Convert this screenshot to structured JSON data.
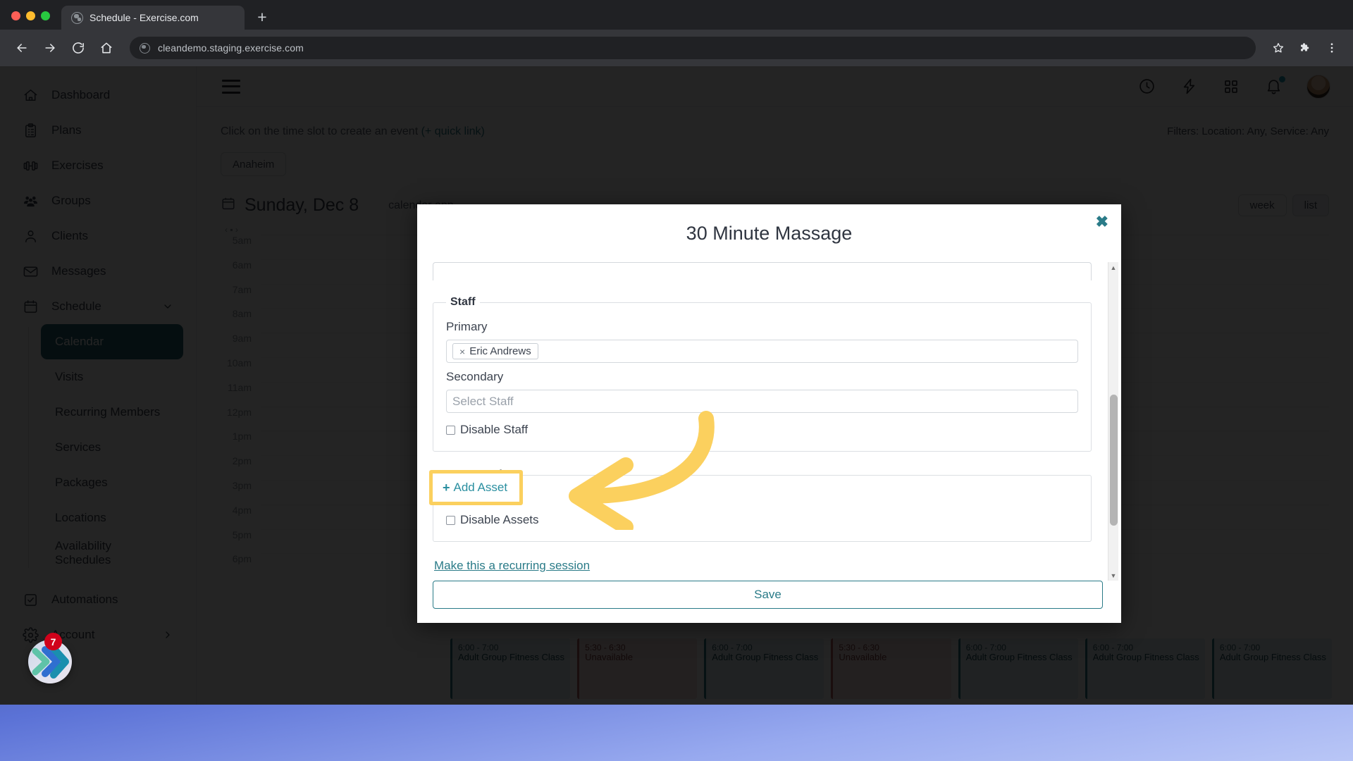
{
  "browser": {
    "tab": {
      "title": "Schedule - Exercise.com",
      "favicon": "globe-icon"
    },
    "new_tab_label": "+",
    "address": "cleandemo.staging.exercise.com",
    "nav": {
      "back": "back-arrow-icon",
      "forward": "forward-arrow-icon",
      "reload": "reload-icon",
      "home": "home-icon",
      "bookmark": "star-icon",
      "extensions": "puzzle-icon",
      "menu": "kebab-menu-icon"
    },
    "traffic_lights": [
      "close",
      "minimize",
      "maximize"
    ]
  },
  "sidebar": {
    "items": [
      {
        "label": "Dashboard",
        "icon": "home-icon"
      },
      {
        "label": "Plans",
        "icon": "clipboard-icon"
      },
      {
        "label": "Exercises",
        "icon": "dumbbell-icon"
      },
      {
        "label": "Groups",
        "icon": "people-icon"
      },
      {
        "label": "Clients",
        "icon": "person-icon"
      },
      {
        "label": "Messages",
        "icon": "envelope-icon"
      },
      {
        "label": "Schedule",
        "icon": "calendar-icon",
        "expanded": true
      }
    ],
    "schedule_subitems": [
      {
        "label": "Calendar",
        "active": true
      },
      {
        "label": "Visits",
        "active": false
      },
      {
        "label": "Recurring Members",
        "active": false
      },
      {
        "label": "Services",
        "active": false
      },
      {
        "label": "Packages",
        "active": false
      },
      {
        "label": "Locations",
        "active": false
      },
      {
        "label": "Availability Schedules",
        "active": false
      }
    ],
    "bottom_items": [
      {
        "label": "Automations",
        "icon": "checkbox-icon"
      },
      {
        "label": "Account",
        "icon": "gear-icon",
        "caret": "chevron-right-icon"
      }
    ]
  },
  "header": {
    "menu_toggle": "hamburger-icon",
    "icons": [
      {
        "name": "clock-icon"
      },
      {
        "name": "lightning-icon"
      },
      {
        "name": "apps-grid-icon"
      },
      {
        "name": "bell-icon",
        "has_badge": true
      }
    ],
    "avatar": "user-avatar"
  },
  "page": {
    "hint_prefix": "Click on the time slot to create an event ",
    "hint_link": "(+ quick link)",
    "filters_label": "Filters: Location: Any, Service: Any",
    "location_chip": "Anaheim",
    "date_title": "Sunday, Dec 8",
    "view_buttons": [
      {
        "label": "week",
        "active": false
      },
      {
        "label": "list",
        "active": true
      }
    ],
    "calendar_app_note": "calendar app",
    "time_labels": [
      "5am",
      "6am",
      "7am",
      "8am",
      "9am",
      "10am",
      "11am",
      "12pm",
      "1pm",
      "2pm",
      "3pm",
      "4pm",
      "5pm",
      "6pm"
    ],
    "events": [
      {
        "time": "6:00 - 7:00",
        "name": "Adult Group Fitness Class",
        "type": "class"
      },
      {
        "time": "5:30 - 6:30",
        "name": "Unavailable",
        "type": "unavailable"
      },
      {
        "time": "6:00 - 7:00",
        "name": "Adult Group Fitness Class",
        "type": "class"
      },
      {
        "time": "5:30 - 6:30",
        "name": "Unavailable",
        "type": "unavailable"
      },
      {
        "time": "6:00 - 7:00",
        "name": "Adult Group Fitness Class",
        "type": "class"
      },
      {
        "time": "6:00 - 7:00",
        "name": "Adult Group Fitness Class",
        "type": "class"
      },
      {
        "time": "6:00 - 7:00",
        "name": "Adult Group Fitness Class",
        "type": "class"
      }
    ]
  },
  "modal": {
    "title": "30 Minute Massage",
    "close_label": "✖",
    "staff": {
      "legend": "Staff",
      "primary_label": "Primary",
      "primary_token": "Eric Andrews",
      "primary_token_remove": "×",
      "secondary_label": "Secondary",
      "secondary_placeholder": "Select Staff",
      "disable_label": "Disable Staff",
      "disable_checked": false
    },
    "asset_rules": {
      "legend": "Asset Rules",
      "add_asset_label": "Add Asset",
      "add_asset_plus": "+",
      "disable_label": "Disable Assets",
      "disable_checked": false
    },
    "recurring_link": "Make this a recurring session",
    "save_label": "Save"
  },
  "annotation": {
    "highlight_target": "Add Asset",
    "highlight_color": "#fbd05e",
    "arrow_color": "#fbd05e",
    "arrow_direction": "points-left-to-add-asset"
  },
  "dock": {
    "app_badge_count": "7",
    "app_icon": "chevron-app-icon"
  },
  "colors": {
    "accent_teal": "#2a7b88",
    "sidebar_active": "#27666f",
    "link": "#2a8fa0",
    "highlight_yellow": "#fbd05e",
    "badge_red": "#d0021b",
    "bell_dot": "#1f9eb5"
  }
}
